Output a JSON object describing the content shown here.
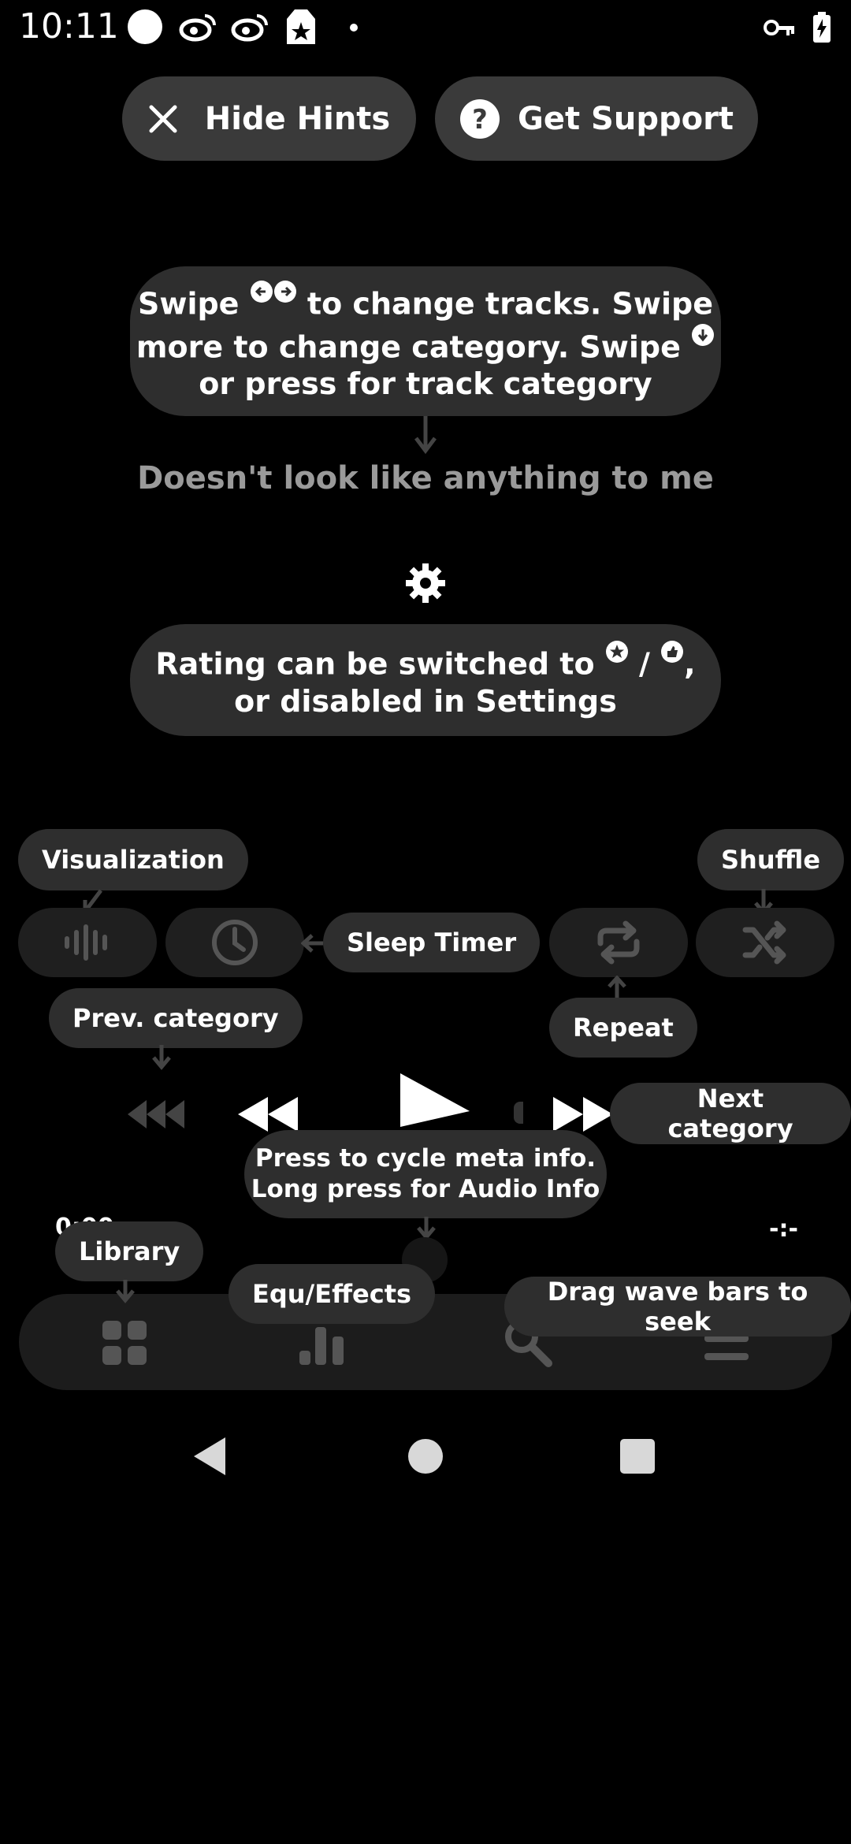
{
  "status_bar": {
    "time": "10:11"
  },
  "top_buttons": {
    "hide_hints": "Hide Hints",
    "get_support": "Get Support"
  },
  "hints": {
    "swipe": {
      "part1": "Swipe",
      "part2": "to change tracks. Swipe",
      "part3": "more to change category. Swipe",
      "part4": "or press for track category"
    },
    "track_title": "Doesn't look like anything to me",
    "rating": {
      "part1": "Rating can be switched to",
      "part2": "/",
      "part3": ",",
      "part4": "or disabled in Settings"
    },
    "visualization": "Visualization",
    "shuffle": "Shuffle",
    "sleep_timer": "Sleep Timer",
    "repeat": "Repeat",
    "prev_category": "Prev. category",
    "next_category": "Next category",
    "meta_info": {
      "line1": "Press to cycle meta info.",
      "line2": "Long press for Audio Info"
    },
    "library": "Library",
    "equ_effects": "Equ/Effects",
    "drag_wave": "Drag wave bars to seek"
  },
  "player": {
    "elapsed_time": "0:00",
    "remaining_time": "-:-"
  }
}
